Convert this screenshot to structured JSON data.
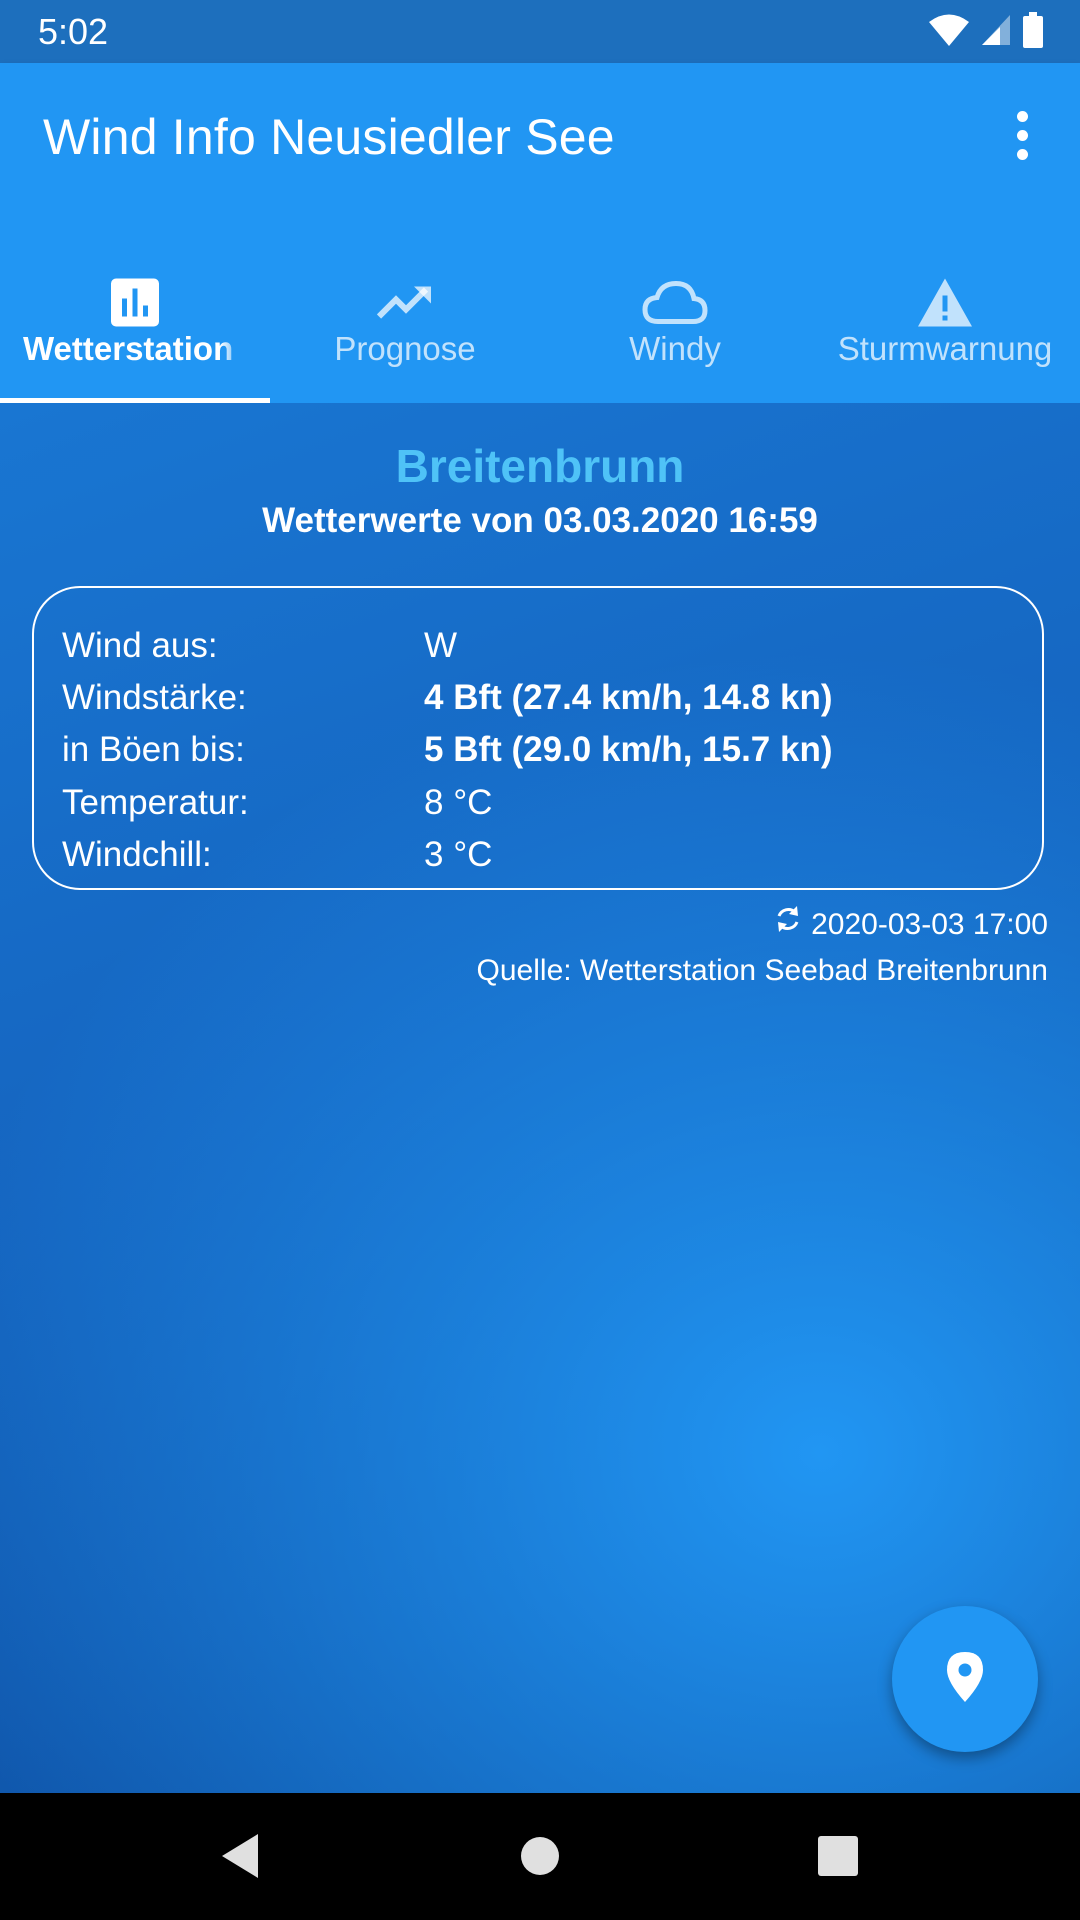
{
  "status_bar": {
    "time": "5:02",
    "icons": [
      "wifi-icon",
      "signal-icon",
      "battery-icon"
    ]
  },
  "app_bar": {
    "title": "Wind Info Neusiedler See",
    "menu_icon": "more-vert-icon"
  },
  "tabs": [
    {
      "label": "Wetterstation",
      "icon": "bar-chart-icon",
      "active": true
    },
    {
      "label": "Prognose",
      "icon": "trending-up-icon",
      "active": false
    },
    {
      "label": "Windy",
      "icon": "cloud-icon",
      "active": false
    },
    {
      "label": "Sturmwarnung",
      "icon": "warning-icon",
      "active": false
    }
  ],
  "station": {
    "name": "Breitenbrunn",
    "values_date": "Wetterwerte von 03.03.2020 16:59",
    "rows": [
      {
        "label": "Wind aus:",
        "value": "W",
        "bold": false
      },
      {
        "label": "Windstärke:",
        "value": "4 Bft (27.4 km/h, 14.8 kn)",
        "bold": true
      },
      {
        "label": "in Böen bis:",
        "value": "5 Bft (29.0 km/h, 15.7 kn)",
        "bold": true
      },
      {
        "label": "Temperatur:",
        "value": "8 °C",
        "bold": false
      },
      {
        "label": "Windchill:",
        "value": "3 °C",
        "bold": false
      }
    ],
    "refresh_time": "2020-03-03 17:00",
    "source": "Quelle: Wetterstation Seebad Breitenbrunn"
  },
  "fab": {
    "icon": "location-pin-icon"
  },
  "nav_bar": {
    "icons": [
      "back-icon",
      "home-icon",
      "recents-icon"
    ]
  },
  "colors": {
    "primary": "#2196f3",
    "status_bar": "#1d6fbd",
    "station_name": "#4fc3f7"
  }
}
